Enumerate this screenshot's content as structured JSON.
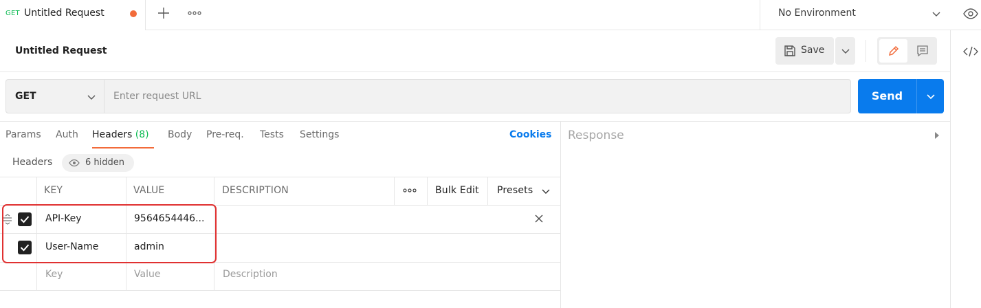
{
  "tab": {
    "method": "GET",
    "title": "Untitled Request"
  },
  "environment": {
    "label": "No Environment"
  },
  "request": {
    "title": "Untitled Request"
  },
  "toolbar": {
    "save_label": "Save"
  },
  "url_bar": {
    "method": "GET",
    "placeholder": "Enter request URL",
    "send_label": "Send"
  },
  "subtabs": {
    "params": "Params",
    "auth": "Auth",
    "headers": "Headers",
    "headers_count": "(8)",
    "body": "Body",
    "prereq": "Pre-req.",
    "tests": "Tests",
    "settings": "Settings",
    "cookies": "Cookies"
  },
  "response": {
    "label": "Response"
  },
  "headers_section": {
    "title": "Headers",
    "hidden": "6 hidden"
  },
  "table": {
    "columns": {
      "key": "KEY",
      "value": "VALUE",
      "description": "DESCRIPTION",
      "bulk_edit": "Bulk Edit",
      "presets": "Presets"
    },
    "rows": [
      {
        "key": "API-Key",
        "value": "9564654446...",
        "description": "",
        "checked": true
      },
      {
        "key": "User-Name",
        "value": "admin",
        "description": "",
        "checked": true
      }
    ],
    "placeholder_row": {
      "key": "Key",
      "value": "Value",
      "description": "Description"
    }
  },
  "colors": {
    "accent": "#f26b3a",
    "primary": "#097bed",
    "method_get": "#0cbb52",
    "highlight": "#e03131"
  }
}
